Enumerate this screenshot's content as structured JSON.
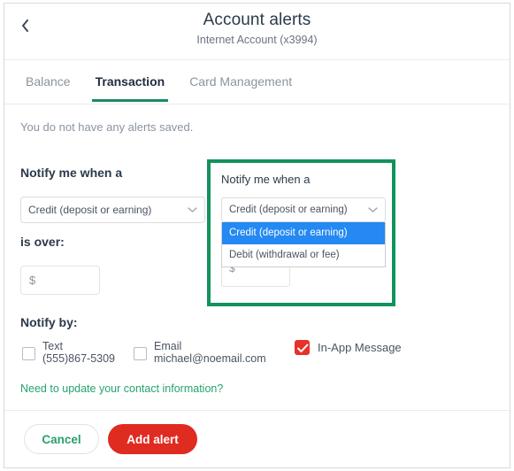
{
  "header": {
    "back_icon": "chevron-left-icon",
    "title": "Account alerts",
    "subtitle": "Internet Account (x3994)"
  },
  "tabs": [
    {
      "label": "Balance",
      "active": false
    },
    {
      "label": "Transaction",
      "active": true
    },
    {
      "label": "Card Management",
      "active": false
    }
  ],
  "main": {
    "empty_state": "You do not have any alerts saved.",
    "notify_when_label": "Notify me when a",
    "trigger_select": {
      "value": "Credit (deposit or earning)",
      "chevron_icon": "chevron-down-icon"
    },
    "is_over_label": "is over:",
    "amount_input": {
      "value": "$",
      "placeholder": "$"
    }
  },
  "callout": {
    "border_color": "#13925c",
    "notify_when_label": "Notify me when a",
    "select": {
      "value": "Credit (deposit or earning)",
      "chevron_icon": "chevron-down-icon"
    },
    "options": [
      {
        "label": "Credit (deposit or earning)",
        "selected": true
      },
      {
        "label": "Debit (withdrawal or fee)",
        "selected": false
      }
    ],
    "amount_input": {
      "value": "$"
    }
  },
  "notify_by": {
    "label": "Notify by:",
    "channels": [
      {
        "name": "text",
        "line1": "Text",
        "line2": "(555)867-5309",
        "checked": false
      },
      {
        "name": "email",
        "line1": "Email",
        "line2": "michael@noemail.com",
        "checked": false
      },
      {
        "name": "in-app",
        "label": "In-App Message",
        "checked": true,
        "check_icon": "check-icon"
      }
    ],
    "contact_link": "Need to update your contact information?"
  },
  "footer": {
    "cancel_label": "Cancel",
    "submit_label": "Add alert"
  },
  "colors": {
    "accent_green": "#1a8a63",
    "callout_green": "#13925c",
    "primary_red": "#e02b21",
    "checkbox_red": "#e8312a",
    "option_highlight_blue": "#2489f2",
    "link_green": "#26a36f"
  }
}
